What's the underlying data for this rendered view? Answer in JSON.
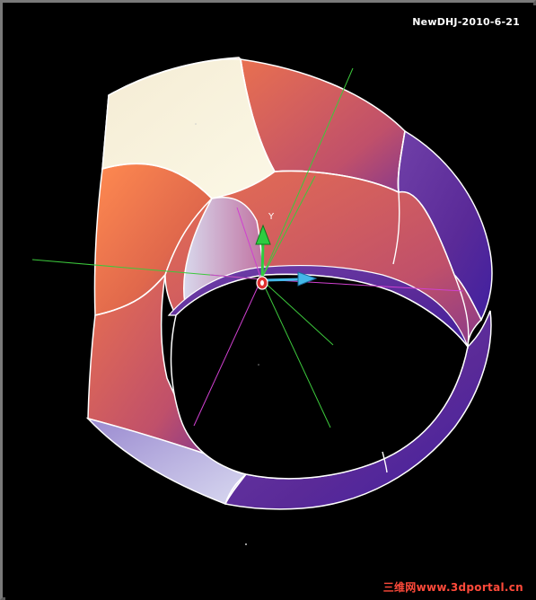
{
  "viewport": {
    "stamp": "NewDHJ-2010-6-21",
    "watermark_cn": "三维网",
    "watermark_url": "www.3dportal.cn",
    "background_color": "#000000"
  },
  "model": {
    "face_colors": {
      "orange": "#f07a4a",
      "cream": "#f7f3dc",
      "lavender": "#c8c8e8",
      "purple": "#5a2ea0",
      "edge": "#ffffff"
    }
  },
  "triad": {
    "y_label": "Y",
    "x_color": "#44b8e8",
    "y_color": "#2ecc40",
    "origin_color": "#e03030"
  },
  "guides": {
    "green_line_color": "#3cc83c",
    "magenta_line_color": "#d040d0"
  }
}
